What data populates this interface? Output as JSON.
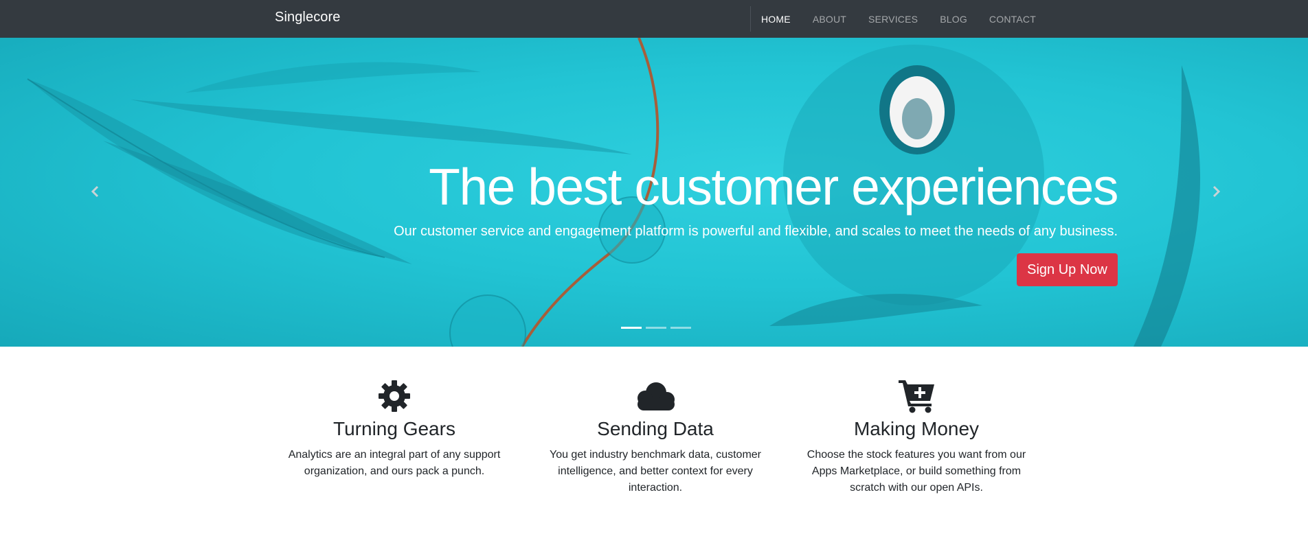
{
  "navbar": {
    "brand": "Singlecore",
    "items": [
      {
        "label": "HOME",
        "active": true
      },
      {
        "label": "ABOUT"
      },
      {
        "label": "SERVICES"
      },
      {
        "label": "BLOG"
      },
      {
        "label": "CONTACT"
      }
    ]
  },
  "hero": {
    "title": "The best customer experiences",
    "subtitle": "Our customer service and engagement platform is powerful and flexible, and scales to meet the needs of any business.",
    "cta_label": "Sign Up Now",
    "prev_icon": "chevron-left-icon",
    "next_icon": "chevron-right-icon",
    "slides_count": 3,
    "active_slide": 1
  },
  "features": [
    {
      "icon": "gear-icon",
      "title": "Turning Gears",
      "text": "Analytics are an integral part of any support organization, and ours pack a punch."
    },
    {
      "icon": "cloud-icon",
      "title": "Sending Data",
      "text": "You get industry benchmark data, customer intelligence, and better context for every interaction."
    },
    {
      "icon": "cart-plus-icon",
      "title": "Making Money",
      "text": "Choose the stock features you want from our Apps Marketplace, or build something from scratch with our open APIs."
    }
  ],
  "colors": {
    "navbar": "#343a40",
    "hero": "#22c4d4",
    "cta": "#dc3545",
    "text": "#212529"
  }
}
